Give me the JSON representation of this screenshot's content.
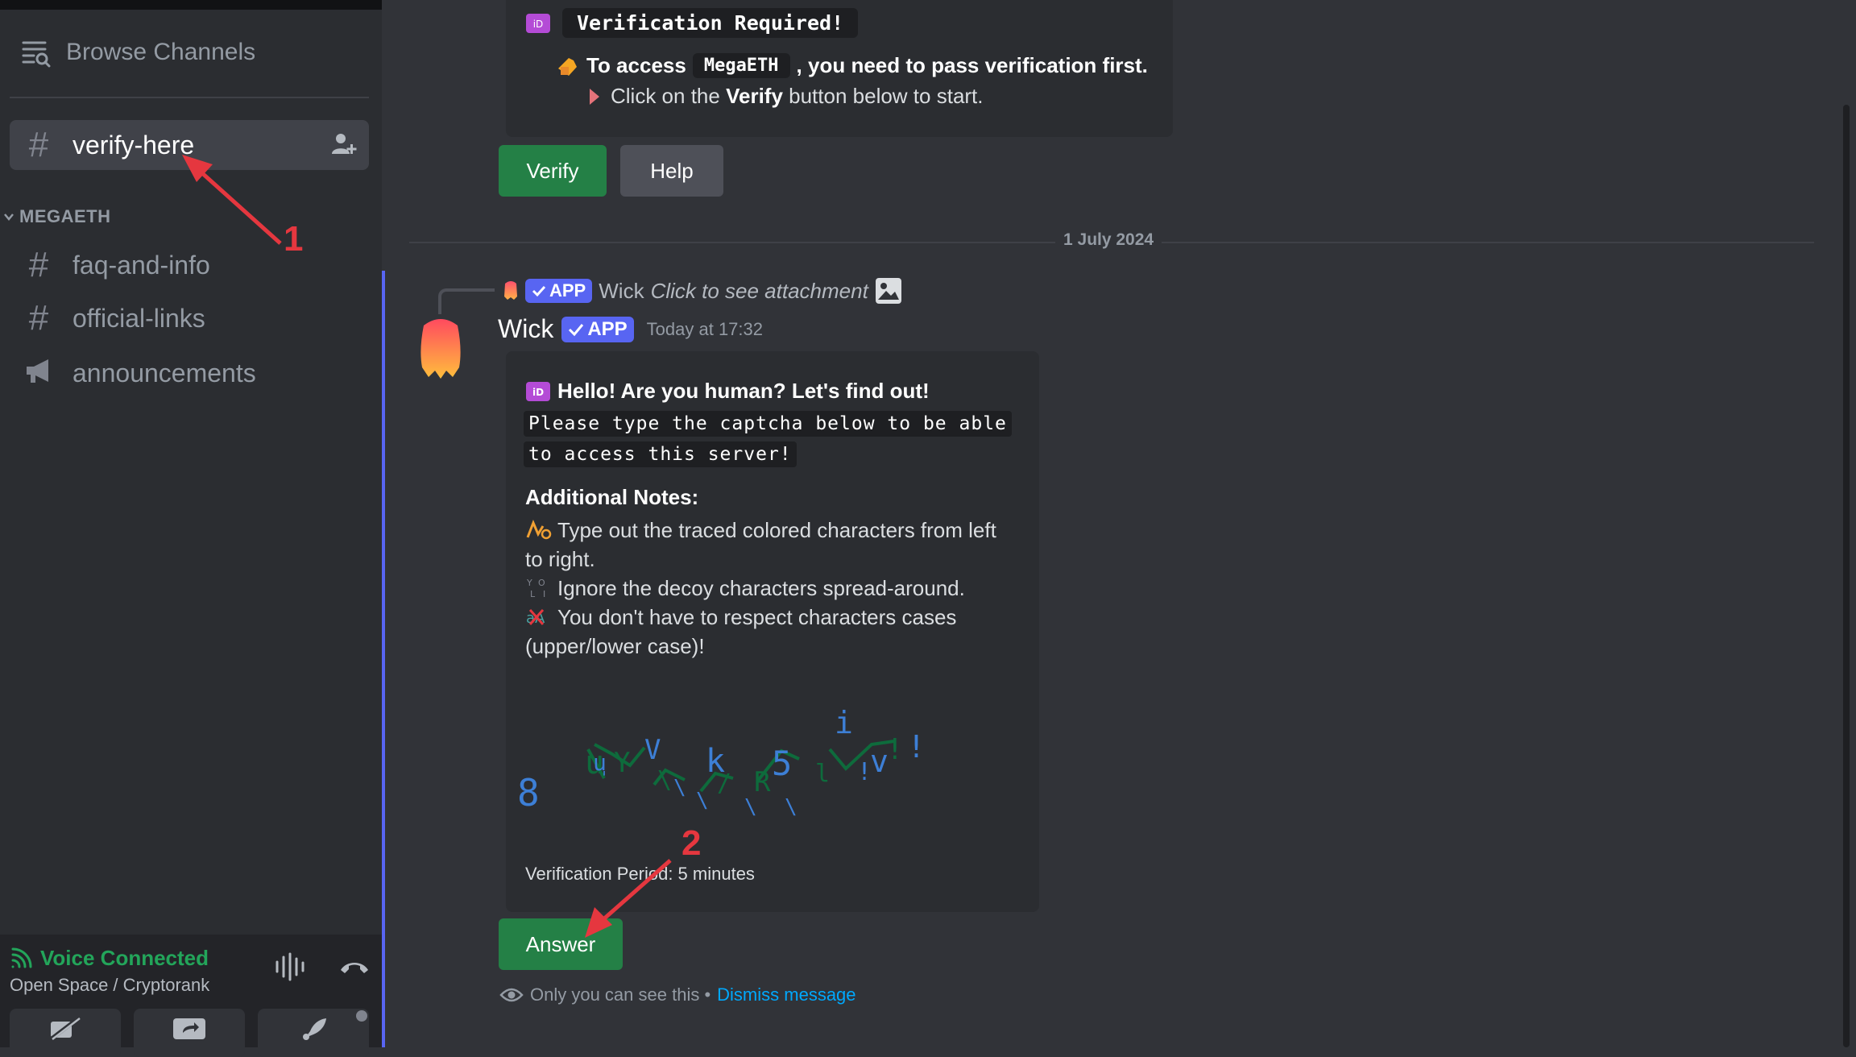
{
  "sidebar": {
    "browse_label": "Browse Channels",
    "active_channel": "verify-here",
    "category": "MEGAETH",
    "channels": [
      {
        "label": "faq-and-info",
        "icon": "hash-icon"
      },
      {
        "label": "official-links",
        "icon": "hash-icon"
      },
      {
        "label": "announcements",
        "icon": "megaphone-icon"
      }
    ],
    "voice": {
      "status": "Voice Connected",
      "location": "Open Space / Cryptorank"
    }
  },
  "chat": {
    "embed1": {
      "title": "Verification Required!",
      "line_prefix": "To access",
      "server_name": "MegaETH",
      "line_suffix": ", you need to pass verification first.",
      "instr_prefix": "Click on the",
      "instr_bold": "Verify",
      "instr_suffix": "button below to start."
    },
    "buttons": {
      "verify": "Verify",
      "help": "Help"
    },
    "date_divider": "1 July 2024",
    "reply": {
      "author": "Wick",
      "badge": "APP",
      "text": "Click to see attachment"
    },
    "message": {
      "author": "Wick",
      "badge": "APP",
      "timestamp": "Today at 17:32",
      "embed": {
        "title": "Hello! Are you human? Let's find out!",
        "code_line1": "Please type the captcha below to be able",
        "code_line2": "to access this server!",
        "notes_title": "Additional Notes:",
        "note1": "Type out the traced colored characters from left to right.",
        "note2": "Ignore the decoy characters spread-around.",
        "note3": "You don't have to respect characters cases (upper/lower case)!",
        "period": "Verification Period: 5 minutes"
      },
      "answer_button": "Answer",
      "ephemeral_note": "Only you can see this •",
      "dismiss_link": "Dismiss message"
    }
  },
  "annotations": {
    "step1": "1",
    "step2": "2"
  },
  "colors": {
    "accent": "#5865f2",
    "success": "#248046",
    "link": "#00a8fc",
    "annotation": "#e5373f"
  }
}
